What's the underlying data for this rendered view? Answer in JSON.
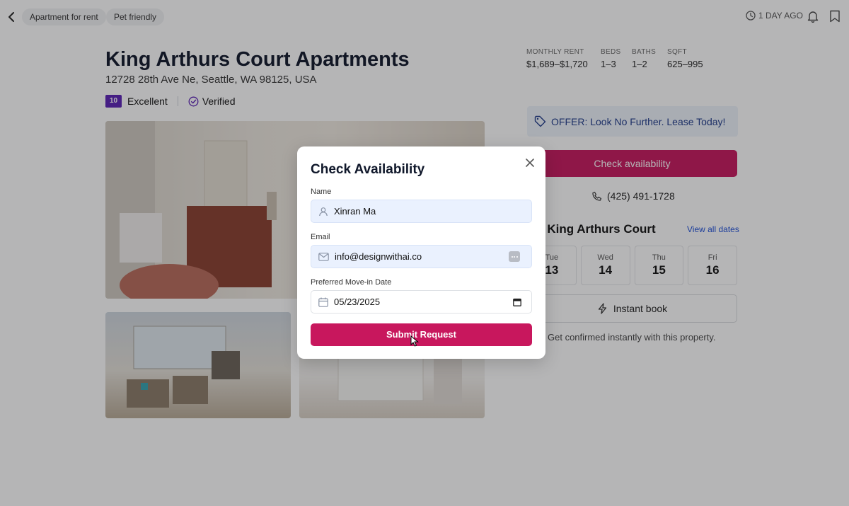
{
  "topbar": {
    "chips": [
      "Apartment for rent",
      "Pet friendly"
    ],
    "posted": "1 DAY AGO"
  },
  "listing": {
    "title": "King Arthurs Court Apartments",
    "address": "12728 28th Ave Ne, Seattle, WA 98125, USA",
    "score": "10",
    "rating_label": "Excellent",
    "verified_label": "Verified"
  },
  "specs": [
    {
      "label": "MONTHLY RENT",
      "value": "$1,689–$1,720"
    },
    {
      "label": "BEDS",
      "value": "1–3"
    },
    {
      "label": "BATHS",
      "value": "1–2"
    },
    {
      "label": "SQFT",
      "value": "625–995"
    }
  ],
  "sidebar": {
    "offer": "OFFER: Look No Further. Lease Today!",
    "check_button": "Check availability",
    "phone": "(425) 491-1728",
    "tour_title": "r King Arthurs Court",
    "view_all": "View all dates",
    "dates": [
      {
        "day": "Tue",
        "num": "13"
      },
      {
        "day": "Wed",
        "num": "14"
      },
      {
        "day": "Thu",
        "num": "15"
      },
      {
        "day": "Fri",
        "num": "16"
      }
    ],
    "instant_book": "Instant book",
    "confirm_text": "Get confirmed instantly with this property."
  },
  "modal": {
    "title": "Check Availability",
    "name_label": "Name",
    "name_value": "Xinran Ma",
    "email_label": "Email",
    "email_value": "info@designwithai.co",
    "date_label": "Preferred Move-in Date",
    "date_value": "05/23/2025",
    "submit": "Submit Request"
  },
  "colors": {
    "accent": "#c8175d",
    "score_badge": "#5b21b6",
    "link": "#1d4ed8",
    "offer_bg": "#eef3fb"
  }
}
